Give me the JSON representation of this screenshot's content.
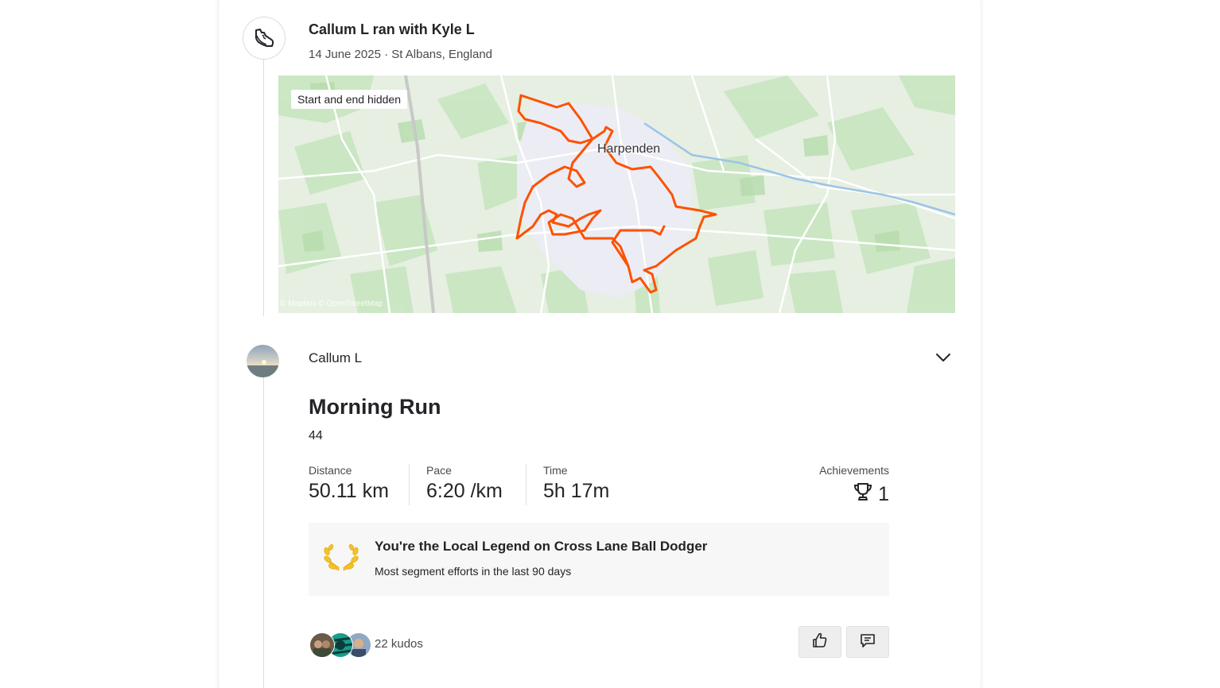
{
  "group": {
    "title": "Callum L ran with Kyle L",
    "meta": "14 June 2025 · St Albans, England",
    "icon": "running-shoe-icon"
  },
  "map": {
    "badge": "Start and end hidden",
    "town": "Harpenden",
    "attribution": "© Mapbox © OpenStreetMap",
    "route_color": "#fc5200"
  },
  "activity": {
    "athlete": "Callum L",
    "title": "Morning Run",
    "description": "44",
    "stats": [
      {
        "label": "Distance",
        "value": "50.11 km"
      },
      {
        "label": "Pace",
        "value": "6:20 /km"
      },
      {
        "label": "Time",
        "value": "5h 17m"
      }
    ],
    "achievements": {
      "label": "Achievements",
      "value": "1",
      "icon": "trophy-icon"
    }
  },
  "legend": {
    "title": "You're the Local Legend on Cross Lane Ball Dodger",
    "subtitle": "Most segment efforts in the last 90 days",
    "icon": "laurel-wreath-icon"
  },
  "kudos": {
    "text": "22 kudos"
  },
  "actions": {
    "kudos_icon": "thumbs-up-icon",
    "comment_icon": "comment-icon"
  }
}
